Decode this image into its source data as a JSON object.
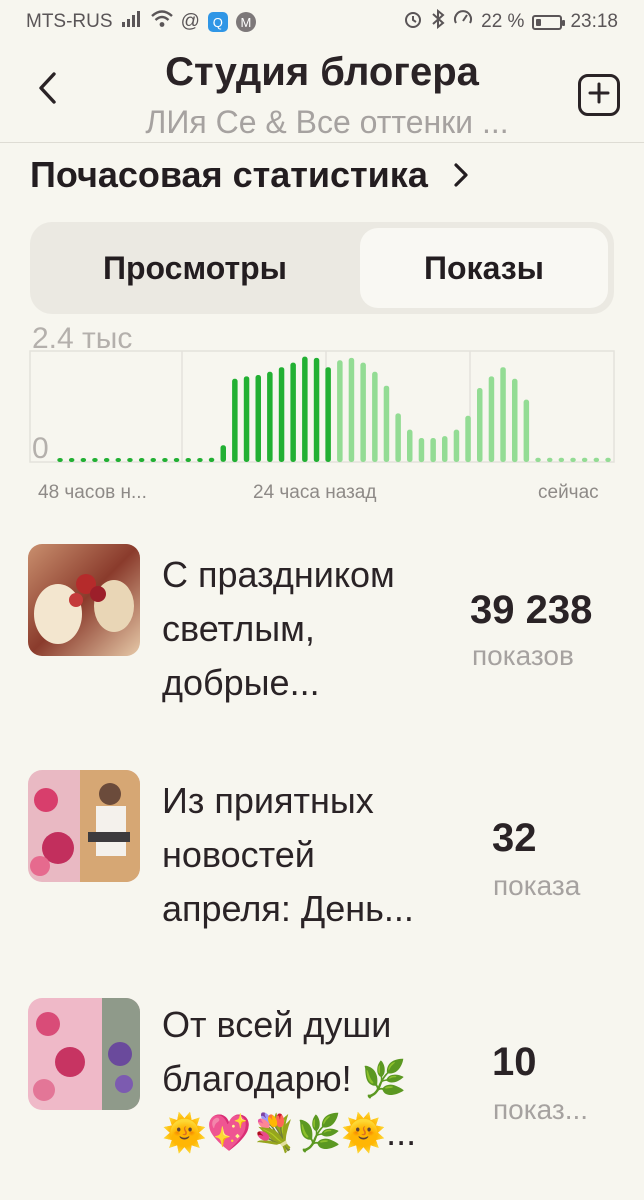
{
  "status_bar": {
    "carrier": "MTS-RUS",
    "battery": "22 %",
    "battery_level": 0.22,
    "time": "23:18"
  },
  "header": {
    "title": "Студия блогера",
    "subtitle": "ЛИя Се & Все оттенки ..."
  },
  "section": {
    "title": "Почасовая статистика"
  },
  "tabs": [
    {
      "label": "Просмотры",
      "selected": false
    },
    {
      "label": "Показы",
      "selected": true
    }
  ],
  "chart_data": {
    "type": "bar",
    "title": "",
    "ylim": [
      0,
      2400
    ],
    "y_tick_labels": [
      "2.4 тыс",
      "0"
    ],
    "x_tick_labels": [
      "48 часов н...",
      "24 часа назад",
      "сейчас"
    ],
    "grid": true,
    "series": [
      {
        "values": [
          40,
          40,
          40,
          40,
          40,
          40,
          40,
          40,
          40,
          40,
          40,
          40,
          40,
          90,
          360,
          1800,
          1850,
          1880,
          1950,
          2050,
          2150,
          2280,
          2250,
          2050
        ]
      },
      {
        "values": [
          2200,
          2250,
          2150,
          1950,
          1650,
          1050,
          700,
          520,
          520,
          560,
          700,
          1000,
          1600,
          1850,
          2050,
          1800,
          1350,
          90,
          90,
          90,
          90,
          90,
          90,
          90
        ]
      }
    ],
    "colors": {
      "past": "#22b033",
      "recent": "#93dc94"
    }
  },
  "posts": [
    {
      "title": "С праздником светлым, добрые...",
      "count": "39 238",
      "unit": "показов"
    },
    {
      "title": "Из приятных новостей апреля: День...",
      "count": "32",
      "unit": "показа"
    },
    {
      "title": "От всей души благодарю! 🌿 🌞💖💐🌿🌞...",
      "count": "10",
      "unit": "показ..."
    }
  ]
}
